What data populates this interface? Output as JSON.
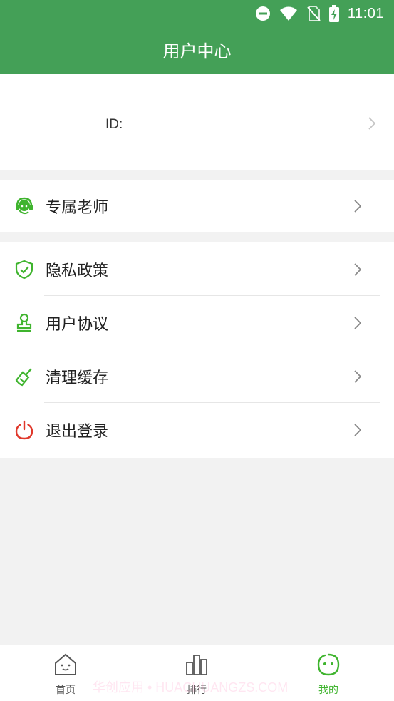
{
  "status_bar": {
    "time": "11:01"
  },
  "header": {
    "title": "用户中心"
  },
  "profile": {
    "id_label": "ID:"
  },
  "menu": {
    "group1": [
      {
        "label": "专属老师",
        "icon": "headset-icon",
        "color": "#3fb42e"
      }
    ],
    "group2": [
      {
        "label": "隐私政策",
        "icon": "shield-icon",
        "color": "#3fb42e"
      },
      {
        "label": "用户协议",
        "icon": "stamp-icon",
        "color": "#3fb42e"
      },
      {
        "label": "清理缓存",
        "icon": "broom-icon",
        "color": "#3fb42e"
      },
      {
        "label": "退出登录",
        "icon": "power-icon",
        "color": "#e0382b"
      }
    ]
  },
  "tabbar": {
    "items": [
      {
        "label": "首页",
        "icon": "home-icon",
        "active": false
      },
      {
        "label": "排行",
        "icon": "ranking-icon",
        "active": false
      },
      {
        "label": "我的",
        "icon": "smile-bubble-icon",
        "active": true
      }
    ]
  },
  "watermark": {
    "text": "华创应用 • HUACHUANGZS.COM"
  },
  "colors": {
    "primary": "#44a057",
    "accent": "#3fb42e",
    "danger": "#e0382b",
    "background": "#f2f2f2"
  }
}
